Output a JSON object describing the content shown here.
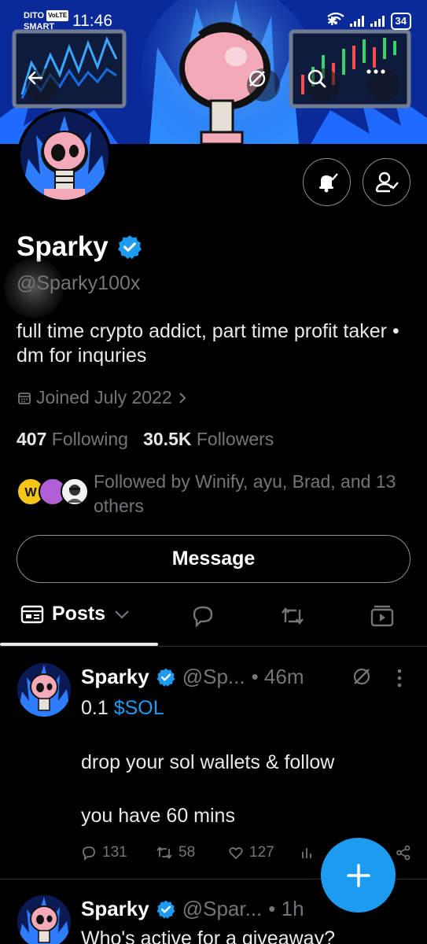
{
  "status_bar": {
    "carrier_line1": "DITO",
    "volte": "VoLTE",
    "carrier_line2": "SMART",
    "time": "11:46",
    "battery": "34"
  },
  "nav": {
    "back_icon": "arrow-left-icon",
    "grok_icon": "grok-icon",
    "search_icon": "search-icon",
    "more_icon": "more-icon"
  },
  "profile": {
    "name": "Sparky",
    "handle": "@Sparky100x",
    "bio": "full time crypto addict, part time profit taker • dm for inqu​ries",
    "joined": "Joined July 2022",
    "following_count": "407",
    "following_label": "Following",
    "followers_count": "30.5K",
    "followers_label": "Followers",
    "followed_by": "Followed by Winify, ayu, Brad, and 13 others",
    "message_label": "Message"
  },
  "tabs": {
    "posts_label": "Posts"
  },
  "posts": [
    {
      "name": "Sparky",
      "handle": "@Sp...",
      "time": "• 46m",
      "line1_prefix": "0.1 ",
      "line1_link": "$SOL",
      "line2": "drop your sol wallets & follow",
      "line3": "you have 60 mins",
      "replies": "131",
      "reposts": "58",
      "likes": "127"
    },
    {
      "name": "Sparky",
      "handle": "@Spar...",
      "time": "• 1h",
      "line1": "Who's active for a giveaway?"
    }
  ],
  "colors": {
    "accent": "#1d9bf0",
    "muted": "#71767b",
    "text": "#e7e9ea"
  }
}
